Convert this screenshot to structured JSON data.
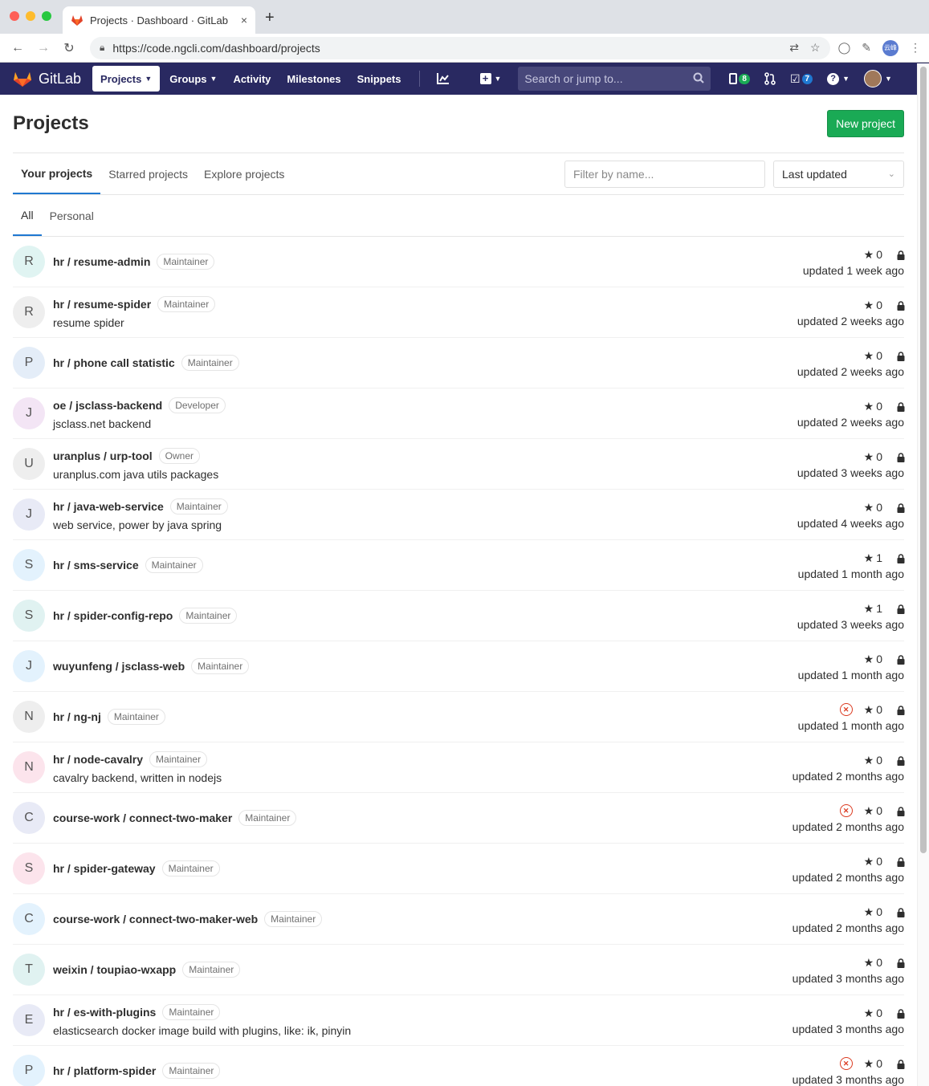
{
  "browser": {
    "tab_title": "Projects · Dashboard · GitLab",
    "tab_close": "×",
    "new_tab": "+",
    "url": "https://code.ngcli.com/dashboard/projects",
    "avatar_text": "云峰"
  },
  "gitlab_nav": {
    "brand": "GitLab",
    "links": [
      "Projects",
      "Groups",
      "Activity",
      "Milestones",
      "Snippets"
    ],
    "search_placeholder": "Search or jump to...",
    "issues_count": "8",
    "todos_count": "7"
  },
  "page": {
    "title": "Projects",
    "new_project_label": "New project",
    "tabs": [
      "Your projects",
      "Starred projects",
      "Explore projects"
    ],
    "filter_placeholder": "Filter by name...",
    "sort_value": "Last updated",
    "subtabs": [
      "All",
      "Personal"
    ]
  },
  "colors": {
    "nav_bg": "#292961",
    "accent_green": "#1aaa55",
    "active_tab": "#1f78d1",
    "failed": "#db3b21"
  },
  "projects": [
    {
      "letter": "R",
      "name": "hr / resume-admin",
      "role": "Maintainer",
      "desc": "",
      "stars": "0",
      "updated": "updated 1 week ago",
      "failed": false,
      "avatar_bg": "#e0f4f2"
    },
    {
      "letter": "R",
      "name": "hr / resume-spider",
      "role": "Maintainer",
      "desc": "resume spider",
      "stars": "0",
      "updated": "updated 2 weeks ago",
      "failed": false,
      "avatar_bg": "#eeeeee"
    },
    {
      "letter": "P",
      "name": "hr / phone call statistic",
      "role": "Maintainer",
      "desc": "",
      "stars": "0",
      "updated": "updated 2 weeks ago",
      "failed": false,
      "avatar_bg": "#e4edf8"
    },
    {
      "letter": "J",
      "name": "oe / jsclass-backend",
      "role": "Developer",
      "desc": "jsclass.net backend",
      "stars": "0",
      "updated": "updated 2 weeks ago",
      "failed": false,
      "avatar_bg": "#f3e5f5"
    },
    {
      "letter": "U",
      "name": "uranplus / urp-tool",
      "role": "Owner",
      "desc": "uranplus.com java utils packages",
      "stars": "0",
      "updated": "updated 3 weeks ago",
      "failed": false,
      "avatar_bg": "#eeeeee"
    },
    {
      "letter": "J",
      "name": "hr / java-web-service",
      "role": "Maintainer",
      "desc": "web service, power by java spring",
      "stars": "0",
      "updated": "updated 4 weeks ago",
      "failed": false,
      "avatar_bg": "#e8eaf6"
    },
    {
      "letter": "S",
      "name": "hr / sms-service",
      "role": "Maintainer",
      "desc": "",
      "stars": "1",
      "updated": "updated 1 month ago",
      "failed": false,
      "avatar_bg": "#e3f2fd"
    },
    {
      "letter": "S",
      "name": "hr / spider-config-repo",
      "role": "Maintainer",
      "desc": "",
      "stars": "1",
      "updated": "updated 3 weeks ago",
      "failed": false,
      "avatar_bg": "#e0f2f1"
    },
    {
      "letter": "J",
      "name": "wuyunfeng / jsclass-web",
      "role": "Maintainer",
      "desc": "",
      "stars": "0",
      "updated": "updated 1 month ago",
      "failed": false,
      "avatar_bg": "#e3f2fd"
    },
    {
      "letter": "N",
      "name": "hr / ng-nj",
      "role": "Maintainer",
      "desc": "",
      "stars": "0",
      "updated": "updated 1 month ago",
      "failed": true,
      "avatar_bg": "#eeeeee"
    },
    {
      "letter": "N",
      "name": "hr / node-cavalry",
      "role": "Maintainer",
      "desc": "cavalry backend, written in nodejs",
      "stars": "0",
      "updated": "updated 2 months ago",
      "failed": false,
      "avatar_bg": "#fce4ec"
    },
    {
      "letter": "C",
      "name": "course-work / connect-two-maker",
      "role": "Maintainer",
      "desc": "",
      "stars": "0",
      "updated": "updated 2 months ago",
      "failed": true,
      "avatar_bg": "#e8eaf6"
    },
    {
      "letter": "S",
      "name": "hr / spider-gateway",
      "role": "Maintainer",
      "desc": "",
      "stars": "0",
      "updated": "updated 2 months ago",
      "failed": false,
      "avatar_bg": "#fce4ec"
    },
    {
      "letter": "C",
      "name": "course-work / connect-two-maker-web",
      "role": "Maintainer",
      "desc": "",
      "stars": "0",
      "updated": "updated 2 months ago",
      "failed": false,
      "avatar_bg": "#e3f2fd"
    },
    {
      "letter": "T",
      "name": "weixin / toupiao-wxapp",
      "role": "Maintainer",
      "desc": "",
      "stars": "0",
      "updated": "updated 3 months ago",
      "failed": false,
      "avatar_bg": "#e0f2f1"
    },
    {
      "letter": "E",
      "name": "hr / es-with-plugins",
      "role": "Maintainer",
      "desc": "elasticsearch docker image build with plugins, like: ik, pinyin",
      "stars": "0",
      "updated": "updated 3 months ago",
      "failed": false,
      "avatar_bg": "#e8eaf6"
    },
    {
      "letter": "P",
      "name": "hr / platform-spider",
      "role": "Maintainer",
      "desc": "",
      "stars": "0",
      "updated": "updated 3 months ago",
      "failed": true,
      "avatar_bg": "#e3f2fd"
    }
  ]
}
